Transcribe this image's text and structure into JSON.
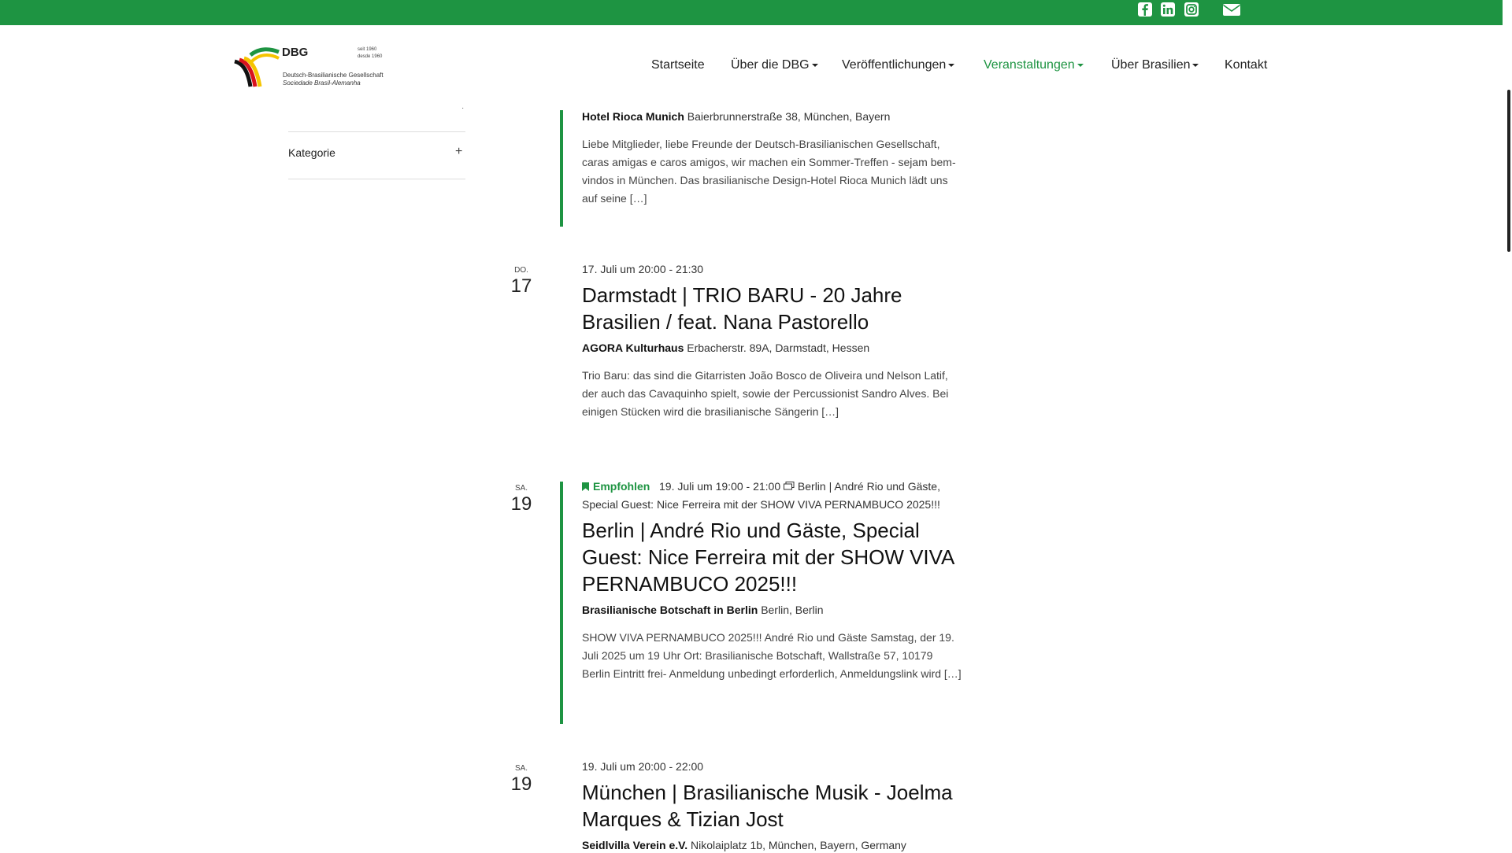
{
  "brand": {
    "name": "DBG",
    "since": "seit 1960",
    "since_pt": "desde 1960",
    "name_de": "Deutsch-Brasilianische Gesellschaft",
    "name_pt": "Sociedade Brasil-Alemanha",
    "accent_color": "#1e9442"
  },
  "social": {
    "icons": [
      "facebook-icon",
      "linkedin-icon",
      "instagram-icon",
      "mail-icon"
    ]
  },
  "nav": {
    "items": [
      {
        "label": "Startseite"
      },
      {
        "label": "Über die DBG"
      },
      {
        "label": "Veröffentlichungen"
      },
      {
        "label": "Veranstaltungen"
      },
      {
        "label": "Über Brasilien"
      },
      {
        "label": "Kontakt"
      }
    ]
  },
  "sidebar": {
    "filter_label": "Kategorie"
  },
  "events": [
    {
      "venue_name": "Hotel Rioca Munich",
      "venue_address": "Baierbrunnerstraße 38, München, Bayern",
      "description": "Liebe Mitglieder, liebe Freunde der Deutsch-Brasilianischen Gesellschaft, caras amigas e caros amigos, wir machen ein Sommer-Treffen - sejam bem-vindos in München. Das brasilianische Design-Hotel Rioca Munich lädt uns auf seine",
      "more": "[…]"
    },
    {
      "day_name": "DO.",
      "day_num": "17",
      "datetime": "17. Juli um 20:00 - 21:30",
      "title": "Darmstadt | TRIO BARU - 20 Jahre Brasilien / feat. Nana Pastorello",
      "venue_name": "AGORA Kulturhaus",
      "venue_address": "Erbacherstr. 89A, Darmstadt, Hessen",
      "description": "Trio Baru: das sind die Gitarristen João Bosco de Oliveira und Nelson Latif, der auch das Cavaquinho spielt, sowie der Percussionist Sandro Alves. Bei einigen Stücken wird die brasilianische Sängerin",
      "more": "[…]"
    },
    {
      "day_name": "SA.",
      "day_num": "19",
      "featured_label": "Empfohlen",
      "datetime": "19. Juli um 19:00 - 21:00",
      "series": "Berlin | André Rio und Gäste, Special Guest: Nice Ferreira mit der SHOW VIVA PERNAMBUCO 2025!!!",
      "title": "Berlin | André Rio und Gäste, Special Guest: Nice Ferreira mit der SHOW VIVA PERNAMBUCO 2025!!!",
      "venue_name": "Brasilianische Botschaft in Berlin",
      "venue_address": "Berlin, Berlin",
      "description": "SHOW VIVA PERNAMBUCO 2025!!! André Rio und Gäste Samstag, der 19. Juli 2025 um 19 Uhr Ort: Brasilianische Botschaft, Wallstraße 57, 10179 Berlin Eintritt frei- Anmeldung unbedingt erforderlich, Anmeldungslink wird",
      "more": "[…]"
    },
    {
      "day_name": "SA.",
      "day_num": "19",
      "datetime": "19. Juli um 20:00 - 22:00",
      "title": "München | Brasilianische Musik - Joelma Marques & Tizian Jost",
      "venue_name": "Seidlvilla Verein e.V.",
      "venue_address": "Nikolaiplatz 1b, München, Bayern, Germany"
    }
  ]
}
